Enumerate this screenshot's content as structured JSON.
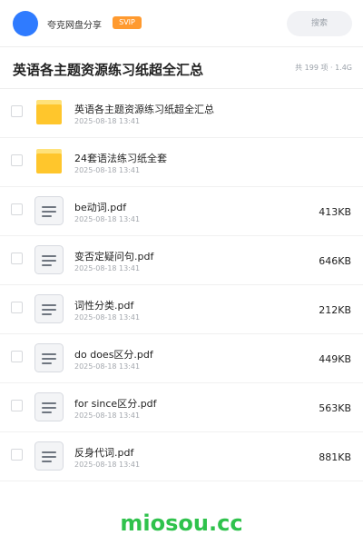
{
  "header": {
    "share_name": "夸克网盘分享",
    "badge": "SVIP",
    "search_label": "搜索",
    "accent_color": "#2f7bff",
    "badge_color": "#ff9a2f"
  },
  "folder": {
    "title": "英语各主题资源练习纸超全汇总",
    "summary": "共 199 项 · 1.4G"
  },
  "items": [
    {
      "type": "folder",
      "icon": "folder-icon",
      "name": "英语各主题资源练习纸超全汇总",
      "date": "2025-08-18 13:41",
      "size": ""
    },
    {
      "type": "folder",
      "icon": "folder-icon",
      "name": "24套语法练习纸全套",
      "date": "2025-08-18 13:41",
      "size": ""
    },
    {
      "type": "file",
      "icon": "document-icon",
      "name": "be动词.pdf",
      "date": "2025-08-18 13:41",
      "size": "413KB"
    },
    {
      "type": "file",
      "icon": "document-icon",
      "name": "变否定疑问句.pdf",
      "date": "2025-08-18 13:41",
      "size": "646KB"
    },
    {
      "type": "file",
      "icon": "document-icon",
      "name": "词性分类.pdf",
      "date": "2025-08-18 13:41",
      "size": "212KB"
    },
    {
      "type": "file",
      "icon": "document-icon",
      "name": "do does区分.pdf",
      "date": "2025-08-18 13:41",
      "size": "449KB"
    },
    {
      "type": "file",
      "icon": "document-icon",
      "name": "for since区分.pdf",
      "date": "2025-08-18 13:41",
      "size": "563KB"
    },
    {
      "type": "file",
      "icon": "document-icon",
      "name": "反身代词.pdf",
      "date": "2025-08-18 13:41",
      "size": "881KB"
    }
  ],
  "watermark": "miosou.cc"
}
